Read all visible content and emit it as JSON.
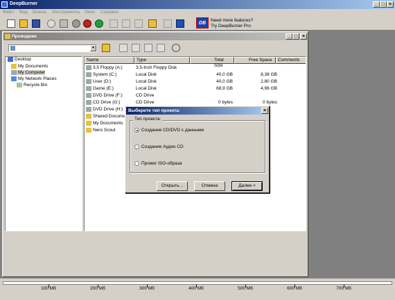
{
  "app": {
    "title": "DeepBurner"
  },
  "menu": [
    "Файл",
    "Вид",
    "Запись",
    "Инструменты",
    "Окно",
    "Справка"
  ],
  "promo": {
    "line1": "Need more features?",
    "line2": "Try DeepBurner Pro",
    "logo": "DB"
  },
  "explorer": {
    "title": "Проводник",
    "columns": [
      "Name",
      "Type",
      "Total Size",
      "Free Space",
      "Comments"
    ],
    "rows": [
      {
        "name": "3.5 Floppy (A:)",
        "type": "3.5-Inch Floppy Disk",
        "total": "",
        "free": ""
      },
      {
        "name": "System (C:)",
        "type": "Local Disk",
        "total": "40,0 GB",
        "free": "8,38 GB"
      },
      {
        "name": "User (D:)",
        "type": "Local Disk",
        "total": "40,0 GB",
        "free": "2,80 GB"
      },
      {
        "name": "Game (E:)",
        "type": "Local Disk",
        "total": "68,9 GB",
        "free": "4,96 GB"
      },
      {
        "name": "DVD Drive (F:)",
        "type": "CD Drive",
        "total": "",
        "free": ""
      },
      {
        "name": "CD Drive (G:)",
        "type": "CD Drive",
        "total": "0 bytes",
        "free": "0 bytes"
      },
      {
        "name": "DVD Drive (H:)",
        "type": "",
        "total": "",
        "free": ""
      },
      {
        "name": "Shared Documen",
        "type": "",
        "total": "",
        "free": ""
      },
      {
        "name": "My Documents",
        "type": "",
        "total": "",
        "free": ""
      },
      {
        "name": "Nero Scout",
        "type": "",
        "total": "",
        "free": ""
      }
    ],
    "tree": [
      "Desktop",
      "My Documents",
      "My Computer",
      "My Network Places",
      "Recycle Bin"
    ]
  },
  "dialog": {
    "title": "Выберите тип проекта:",
    "group_label": "Тип проекта:",
    "options": [
      "Создание CD/DVD с данными",
      "Создание Аудио CD",
      "Прожиг ISO-образа"
    ],
    "selected": 0,
    "buttons": {
      "open": "Открыть...",
      "cancel": "Отмена",
      "next": "Далее >"
    }
  },
  "ruler": {
    "labels": [
      "100 Мб",
      "200 Мб",
      "300 Мб",
      "400 Мб",
      "500 Мб",
      "600 Мб",
      "700 Мб"
    ]
  }
}
